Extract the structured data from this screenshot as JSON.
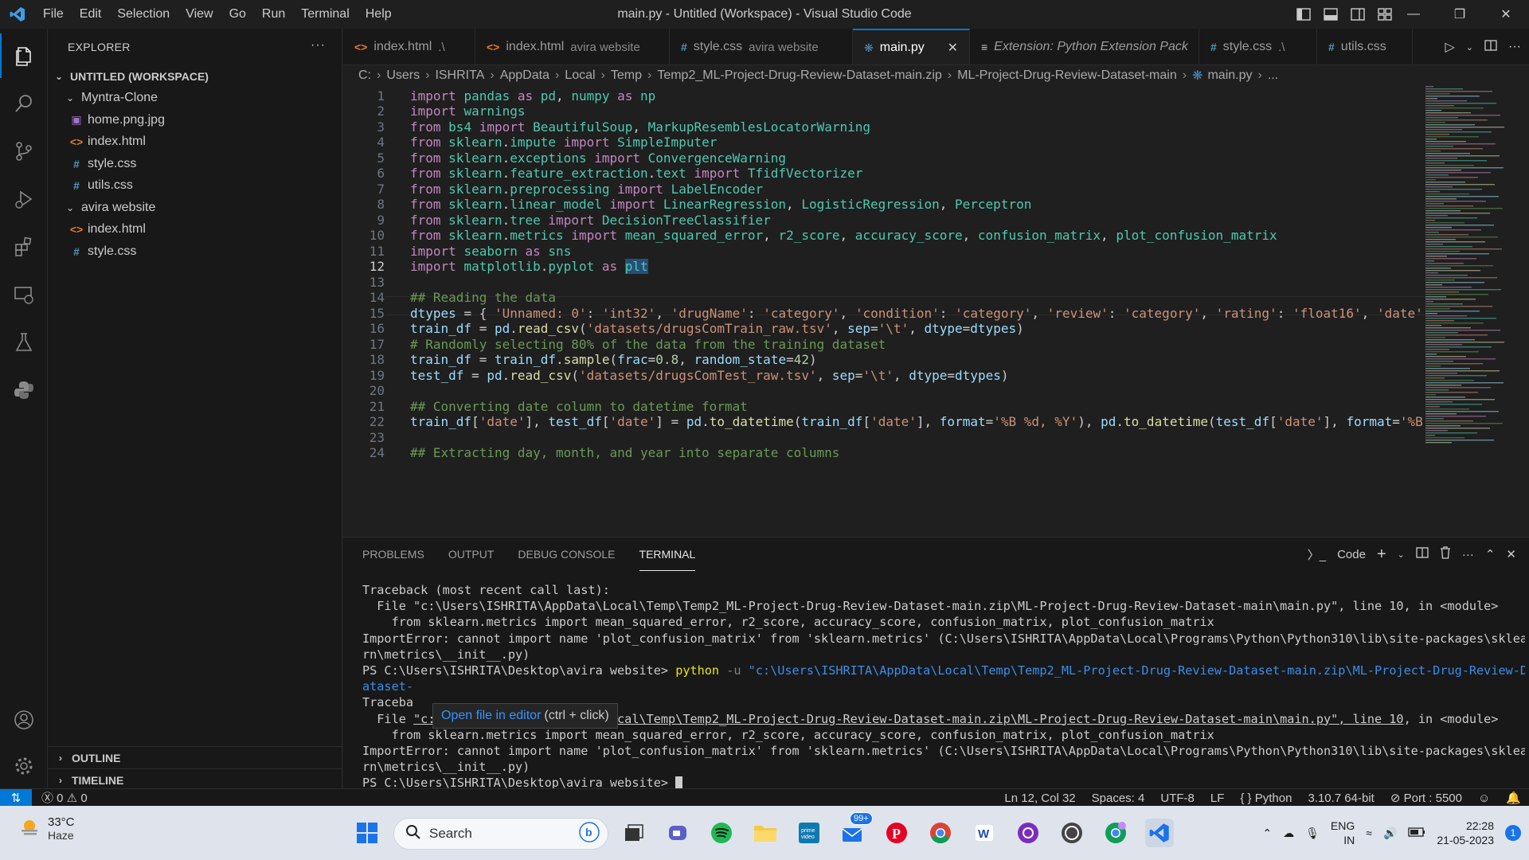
{
  "window": {
    "title": "main.py - Untitled (Workspace) - Visual Studio Code",
    "menu": [
      "File",
      "Edit",
      "Selection",
      "View",
      "Go",
      "Run",
      "Terminal",
      "Help"
    ]
  },
  "sidebar": {
    "title": "EXPLORER",
    "workspace": "UNTITLED (WORKSPACE)",
    "folder1": "Myntra-Clone",
    "folder1_files": [
      "home.png.jpg",
      "index.html",
      "style.css",
      "utils.css"
    ],
    "folder2": "avira website",
    "folder2_files": [
      "index.html",
      "style.css"
    ],
    "outline": "OUTLINE",
    "timeline": "TIMELINE"
  },
  "tabs": [
    {
      "label": "index.html",
      "sub": ".\\"
    },
    {
      "label": "index.html",
      "sub": "avira website"
    },
    {
      "label": "style.css",
      "sub": "avira website"
    },
    {
      "label": "main.py",
      "sub": ""
    },
    {
      "label": "Extension: Python Extension Pack",
      "sub": ""
    },
    {
      "label": "style.css",
      "sub": ".\\"
    },
    {
      "label": "utils.css",
      "sub": ""
    }
  ],
  "breadcrumb": [
    "C:",
    "Users",
    "ISHRITA",
    "AppData",
    "Local",
    "Temp",
    "Temp2_ML-Project-Drug-Review-Dataset-main.zip",
    "ML-Project-Drug-Review-Dataset-main",
    "main.py",
    "..."
  ],
  "code": [
    "import pandas as pd, numpy as np",
    "import warnings",
    "from bs4 import BeautifulSoup, MarkupResemblesLocatorWarning",
    "from sklearn.impute import SimpleImputer",
    "from sklearn.exceptions import ConvergenceWarning",
    "from sklearn.feature_extraction.text import TfidfVectorizer",
    "from sklearn.preprocessing import LabelEncoder",
    "from sklearn.linear_model import LinearRegression, LogisticRegression, Perceptron",
    "from sklearn.tree import DecisionTreeClassifier",
    "from sklearn.metrics import mean_squared_error, r2_score, accuracy_score, confusion_matrix, plot_confusion_matrix",
    "import seaborn as sns",
    "import matplotlib.pyplot as plt",
    "",
    "## Reading the data",
    "dtypes = { 'Unnamed: 0': 'int32', 'drugName': 'category', 'condition': 'category', 'review': 'category', 'rating': 'float16', 'date'",
    "train_df = pd.read_csv('datasets/drugsComTrain_raw.tsv', sep='\\t', dtype=dtypes)",
    "# Randomly selecting 80% of the data from the training dataset",
    "train_df = train_df.sample(frac=0.8, random_state=42)",
    "test_df = pd.read_csv('datasets/drugsComTest_raw.tsv', sep='\\t', dtype=dtypes)",
    "",
    "## Converting date column to datetime format",
    "train_df['date'], test_df['date'] = pd.to_datetime(train_df['date'], format='%B %d, %Y'), pd.to_datetime(test_df['date'], format='%B",
    "",
    "## Extracting day, month, and year into separate columns"
  ],
  "current_line": 12,
  "panel": {
    "tabs": [
      "PROBLEMS",
      "OUTPUT",
      "DEBUG CONSOLE",
      "TERMINAL"
    ],
    "active": "TERMINAL",
    "shell_label": "Code"
  },
  "terminal": [
    "Traceback (most recent call last):",
    "  File \"c:\\Users\\ISHRITA\\AppData\\Local\\Temp\\Temp2_ML-Project-Drug-Review-Dataset-main.zip\\ML-Project-Drug-Review-Dataset-main\\main.py\", line 10, in <module>",
    "    from sklearn.metrics import mean_squared_error, r2_score, accuracy_score, confusion_matrix, plot_confusion_matrix",
    "ImportError: cannot import name 'plot_confusion_matrix' from 'sklearn.metrics' (C:\\Users\\ISHRITA\\AppData\\Local\\Programs\\Python\\Python310\\lib\\site-packages\\sklea",
    "rn\\metrics\\__init__.py)",
    "PS C:\\Users\\ISHRITA\\Desktop\\avira website> ",
    "ataset-",
    "Traceba",
    "  File ",
    "    from sklearn.metrics import mean_squared_error, r2_score, accuracy_score, confusion_matrix, plot_confusion_matrix",
    "ImportError: cannot import name 'plot_confusion_matrix' from 'sklearn.metrics' (C:\\Users\\ISHRITA\\AppData\\Local\\Programs\\Python\\Python310\\lib\\site-packages\\sklea",
    "rn\\metrics\\__init__.py)",
    "PS C:\\Users\\ISHRITA\\Desktop\\avira website> "
  ],
  "terminal_cmd": {
    "exe": "python",
    "flag": "-u",
    "path": "\"c:\\Users\\ISHRITA\\AppData\\Local\\Temp\\Temp2_ML-Project-Drug-Review-Dataset-main.zip\\ML-Project-Drug-Review-D",
    "link_file": "\"c:\\Users\\ISHRITA\\AppData\\Local\\Temp\\Temp2_ML-Project-Drug-Review-Dataset-main.zip\\ML-Project-Drug-Review-Dataset-main\\main.py\", line 10",
    "link_tail": ", in <module>"
  },
  "tooltip": {
    "link": "Open file in editor",
    "hint": "(ctrl + click)"
  },
  "statusbar": {
    "errors": "0",
    "warnings": "0",
    "position": "Ln 12, Col 32",
    "spaces": "Spaces: 4",
    "encoding": "UTF-8",
    "eol": "LF",
    "language": "Python",
    "interpreter": "3.10.7 64-bit",
    "port": "Port : 5500"
  },
  "taskbar": {
    "weather_temp": "33°C",
    "weather_cond": "Haze",
    "search": "Search",
    "mail_badge": "99+",
    "lang1": "ENG",
    "lang2": "IN",
    "time": "22:28",
    "date": "21-05-2023",
    "notif_count": "1"
  },
  "colors": {
    "accent": "#0078d4",
    "keyword": "#c586c0",
    "module": "#4ec9b0",
    "string": "#ce9178",
    "comment": "#6a9955"
  }
}
